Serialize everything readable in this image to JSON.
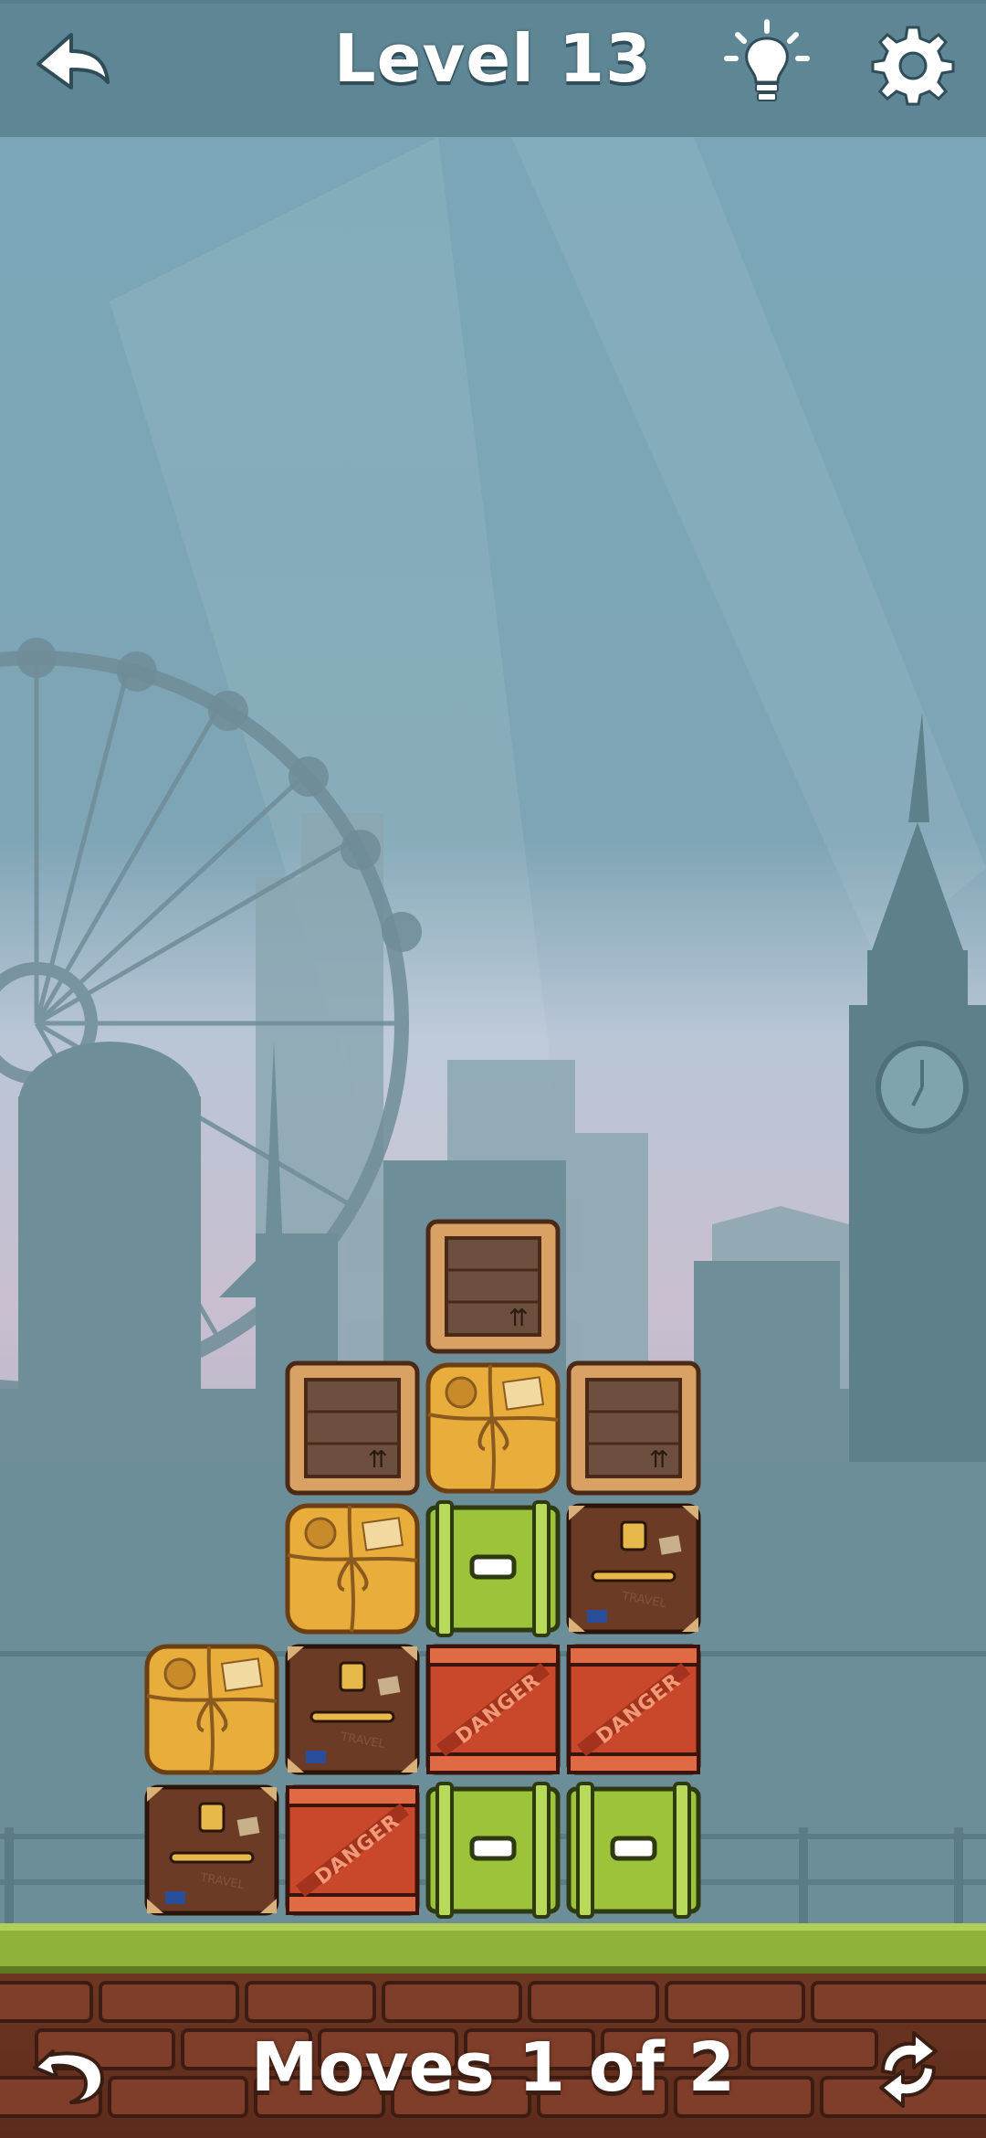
{
  "header": {
    "level_title": "Level 13",
    "back_icon": "arrow-left-icon",
    "hint_icon": "lightbulb-icon",
    "settings_icon": "gear-icon"
  },
  "footer": {
    "moves_text": "Moves 1 of 2",
    "undo_icon": "undo-icon",
    "restart_icon": "restart-icon"
  },
  "colors": {
    "sky": "#7fa6b6",
    "topbar": "#5f8694",
    "grass": "#8fb23a",
    "brick": "#7a3a26",
    "wood_crate": "#d9a264",
    "parcel": "#e8ad3a",
    "green_crate": "#9cc33a",
    "danger_crate": "#c9472a",
    "suitcase": "#6b3b26"
  },
  "board": {
    "rows": [
      [
        "",
        "",
        "wood",
        "",
        ""
      ],
      [
        "",
        "wood",
        "parcel",
        "wood",
        ""
      ],
      [
        "",
        "parcel",
        "green",
        "suitcase",
        ""
      ],
      [
        "parcel",
        "suitcase",
        "danger",
        "danger",
        ""
      ],
      [
        "suitcase",
        "danger",
        "green",
        "green",
        ""
      ]
    ],
    "danger_label": "DANGER",
    "suitcase_label": "TRAVEL"
  }
}
